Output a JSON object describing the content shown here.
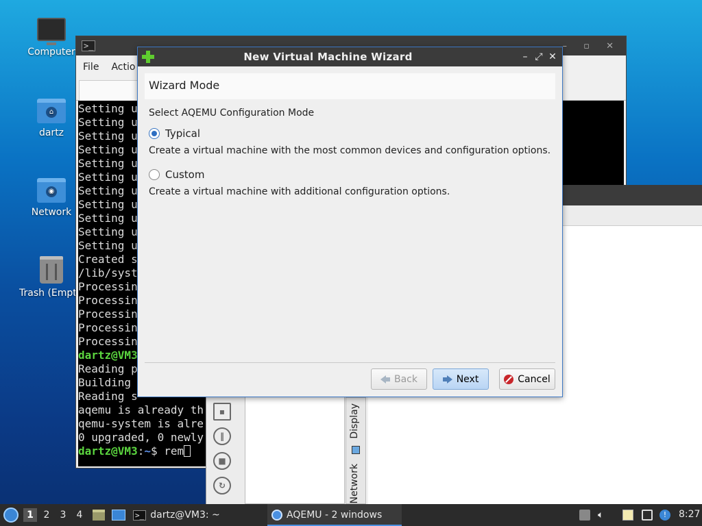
{
  "desktop": {
    "icons": [
      {
        "label": "Computer"
      },
      {
        "label": "dartz"
      },
      {
        "label": "Network"
      },
      {
        "label": "Trash (Empty)"
      }
    ]
  },
  "terminal": {
    "title": "dartz@VM3: ~",
    "menu": [
      "File",
      "Actio"
    ],
    "lines": [
      "Setting u",
      "Setting u",
      "Setting u",
      "Setting u",
      "Setting u",
      "Setting u",
      "Setting u",
      "Setting u",
      "Setting u",
      "Setting u",
      "Setting u",
      "Created s",
      "/lib/syst",
      "Processin",
      "Processin",
      "Processin",
      "Processin",
      "Processin"
    ],
    "prompt1": {
      "user": "dartz@VM3",
      "path": "~",
      "symbol": "$"
    },
    "lines2": [
      "Reading p",
      "Building ",
      "Reading s",
      "aqemu is already th",
      "qemu-system is alre",
      "0 upgraded, 0 newly"
    ],
    "prompt2": {
      "user": "dartz@VM3",
      "path": "~",
      "symbol": "$",
      "command": "rem"
    }
  },
  "aqemu": {
    "vtabs": [
      "Display",
      "Network"
    ]
  },
  "dialog": {
    "title": "New Virtual Machine Wizard",
    "header": "Wizard Mode",
    "section_label": "Select AQEMU Configuration Mode",
    "options": [
      {
        "label": "Typical",
        "description": "Create a virtual machine with the most common devices and configuration options.",
        "checked": true
      },
      {
        "label": "Custom",
        "description": "Create a virtual machine with additional configuration options.",
        "checked": false
      }
    ],
    "buttons": {
      "back": "Back",
      "next": "Next",
      "cancel": "Cancel"
    }
  },
  "taskbar": {
    "workspaces": [
      "1",
      "2",
      "3",
      "4"
    ],
    "tasks": [
      {
        "label": "dartz@VM3: ~",
        "icon": "terminal-icon"
      },
      {
        "label": "AQEMU - 2 windows",
        "icon": "aqemu-icon"
      }
    ],
    "clock": "8:27"
  },
  "colors": {
    "accent": "#3d78c4",
    "prompt_green": "#5bd53f",
    "prompt_blue": "#5c8ee6"
  }
}
